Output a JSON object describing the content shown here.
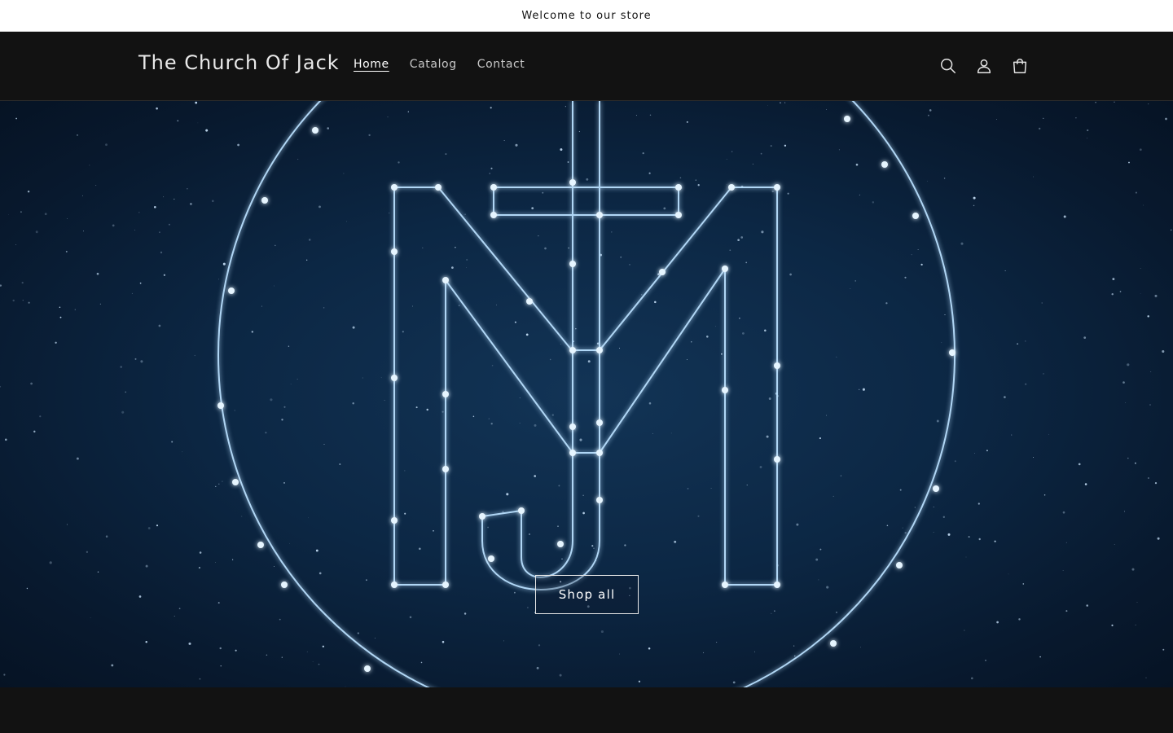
{
  "announcement": {
    "text": "Welcome to our store"
  },
  "header": {
    "brand": "The Church Of Jack",
    "nav": [
      {
        "label": "Home",
        "active": true
      },
      {
        "label": "Catalog",
        "active": false
      },
      {
        "label": "Contact",
        "active": false
      }
    ],
    "icons": [
      "search-icon",
      "account-icon",
      "cart-icon"
    ]
  },
  "hero": {
    "button_label": "Shop all",
    "image_description_icon": "constellation-monogram-logo"
  },
  "colors": {
    "accent": "#ffffff",
    "background": "#121212",
    "hero_glow": "#a9d8ff"
  }
}
